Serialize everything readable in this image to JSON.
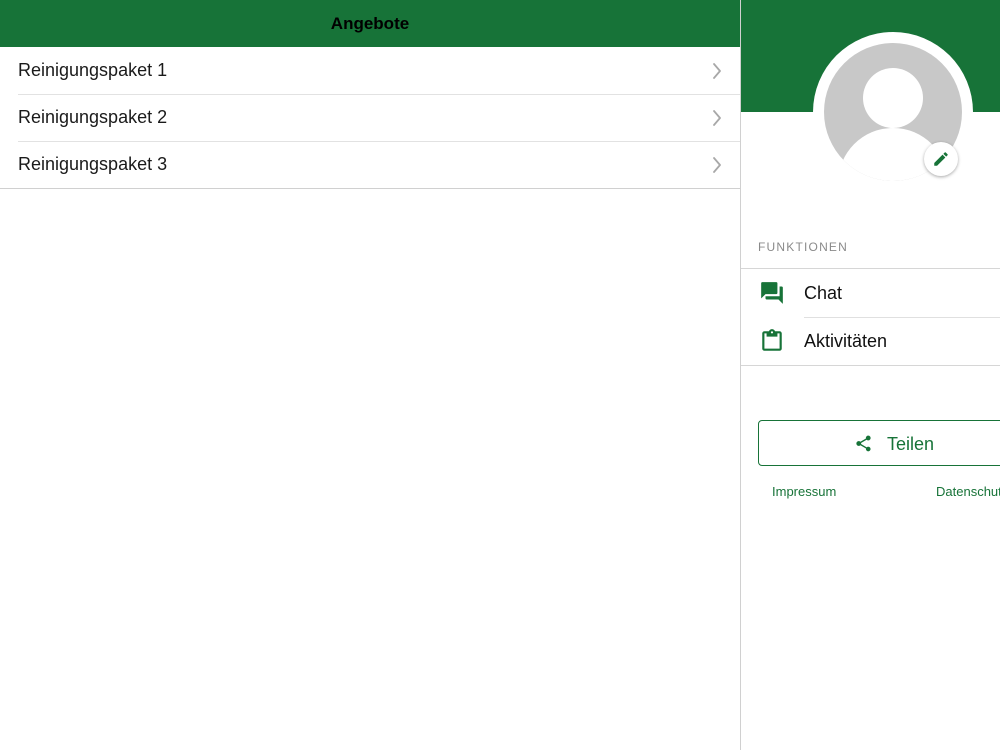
{
  "colors": {
    "brand_green": "#177338",
    "separator": "#d0d0d0",
    "avatar_grey": "#c8c8c8"
  },
  "left_pane": {
    "nav_title": "Angebote",
    "offers": [
      {
        "label": "Reinigungspaket 1",
        "icon": "chevron-right-icon"
      },
      {
        "label": "Reinigungspaket 2",
        "icon": "chevron-right-icon"
      },
      {
        "label": "Reinigungspaket 3",
        "icon": "chevron-right-icon"
      }
    ]
  },
  "right_pane": {
    "avatar_icon": "person-placeholder-icon",
    "edit_icon": "pencil-icon",
    "section_header": "FUNKTIONEN",
    "functions": [
      {
        "label": "Chat",
        "icon": "chat-bubbles-icon"
      },
      {
        "label": "Aktivitäten",
        "icon": "clipboard-icon"
      }
    ],
    "share_button": {
      "label": "Teilen",
      "icon": "share-icon"
    },
    "footer_links": {
      "impressum": "Impressum",
      "datenschutz": "Datenschutz"
    }
  }
}
